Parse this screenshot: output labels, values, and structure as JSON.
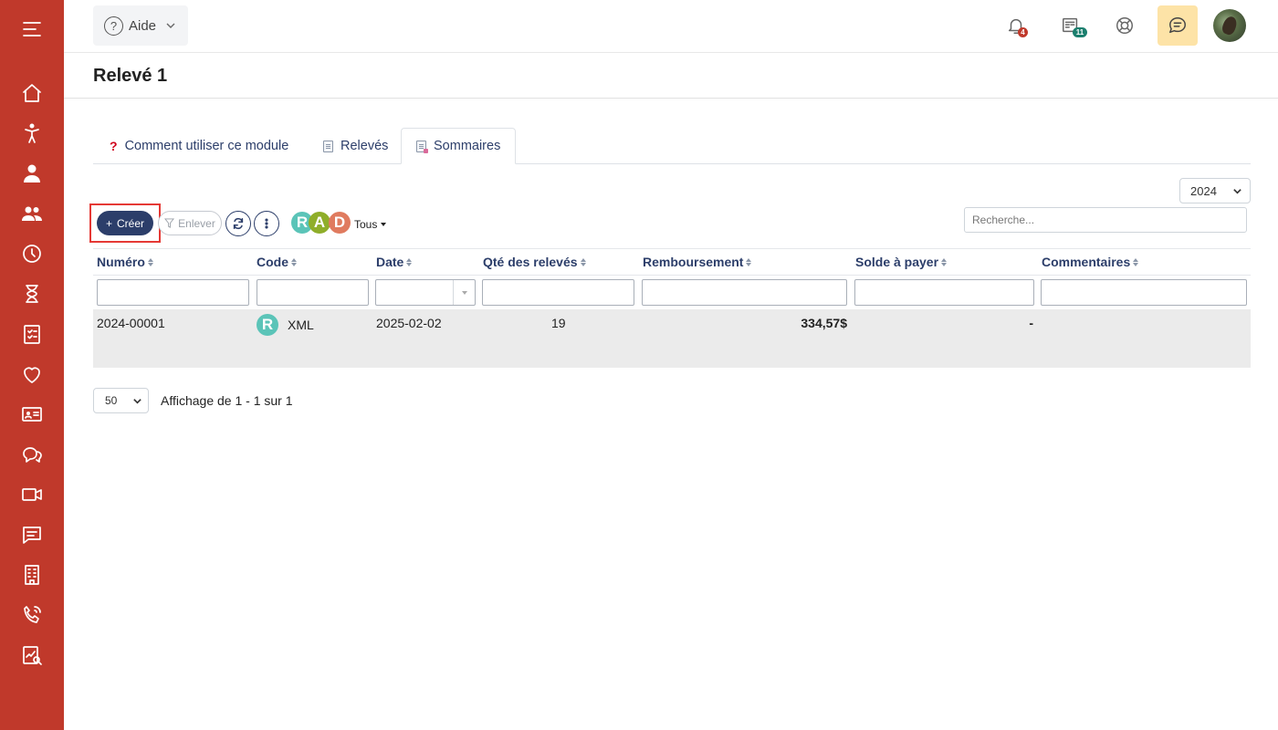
{
  "sidebar": {
    "items": [
      {
        "icon": "menu-icon"
      },
      {
        "icon": "home-icon"
      },
      {
        "icon": "child-icon"
      },
      {
        "icon": "user-icon"
      },
      {
        "icon": "users-icon"
      },
      {
        "icon": "clock-icon"
      },
      {
        "icon": "hourglass-icon"
      },
      {
        "icon": "checklist-icon"
      },
      {
        "icon": "heart-icon"
      },
      {
        "icon": "id-card-icon"
      },
      {
        "icon": "chat-bubbles-icon"
      },
      {
        "icon": "video-icon"
      },
      {
        "icon": "message-icon"
      },
      {
        "icon": "building-icon"
      },
      {
        "icon": "phone-icon"
      },
      {
        "icon": "report-icon"
      }
    ],
    "color": "#c0392b"
  },
  "header": {
    "help_label": "Aide",
    "help_icon": "question-circle-icon",
    "notifications_badge": "4",
    "news_badge": "11"
  },
  "page": {
    "title": "Relevé 1"
  },
  "tabs": [
    {
      "label": "Comment utiliser ce module",
      "icon": "question-mark-icon"
    },
    {
      "label": "Relevés",
      "icon": "document-icon"
    },
    {
      "label": "Sommaires",
      "icon": "document-icon",
      "active": true
    }
  ],
  "filters": {
    "year": "2024",
    "year_options": [
      "2024"
    ],
    "search_placeholder": "Recherche..."
  },
  "toolbar": {
    "create_label": "Créer",
    "remove_label": "Enlever",
    "rad": [
      "R",
      "A",
      "D"
    ],
    "rad_colors": [
      "#5bc4b8",
      "#8fae2a",
      "#e07b5f"
    ],
    "status_filter": "Tous"
  },
  "table": {
    "columns": [
      "Numéro",
      "Code",
      "Date",
      "Qté des relevés",
      "Remboursement",
      "Solde à payer",
      "Commentaires"
    ],
    "rows": [
      {
        "numero": "2024-00001",
        "code_badge": "R",
        "code": "XML",
        "date": "2025-02-02",
        "qte": "19",
        "remboursement": "334,57$",
        "solde": "-",
        "commentaires": ""
      }
    ]
  },
  "pagination": {
    "page_size": "50",
    "info": "Affichage de 1 - 1 sur 1"
  },
  "colors": {
    "primary": "#2c3e6a",
    "sidebar": "#c0392b",
    "highlight": "#e53935",
    "row_bg": "#ebebeb"
  }
}
